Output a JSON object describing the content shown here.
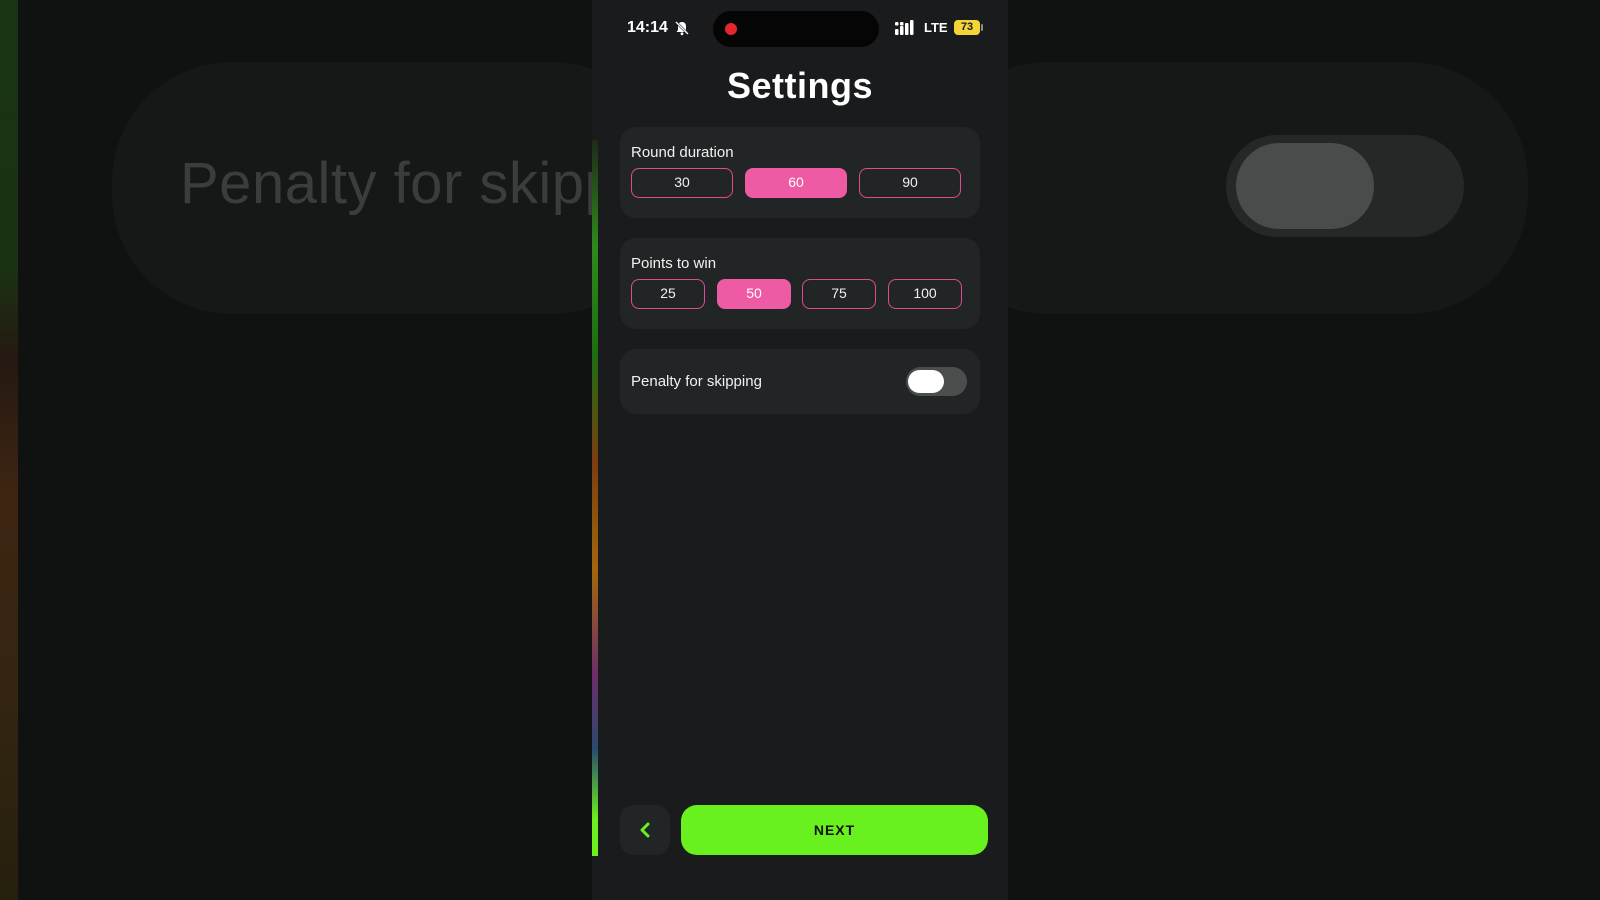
{
  "background": {
    "blurred_label": "Penalty for skipp"
  },
  "status_bar": {
    "time": "14:14",
    "network": "LTE",
    "battery": "73",
    "icons": [
      "bell-off-icon",
      "recording-dot-icon",
      "signal-icon",
      "battery-icon"
    ]
  },
  "page": {
    "title": "Settings"
  },
  "round_duration": {
    "label": "Round duration",
    "options": [
      "30",
      "60",
      "90"
    ],
    "selected": "60"
  },
  "points_to_win": {
    "label": "Points to win",
    "options": [
      "25",
      "50",
      "75",
      "100"
    ],
    "selected": "50"
  },
  "penalty": {
    "label": "Penalty for skipping",
    "enabled": false
  },
  "footer": {
    "back_icon": "chevron-left-icon",
    "next_label": "NEXT"
  },
  "colors": {
    "accent_pink": "#ee5aa4",
    "accent_green": "#69f01f",
    "card_bg": "#222525",
    "screen_bg": "#191b1c"
  }
}
